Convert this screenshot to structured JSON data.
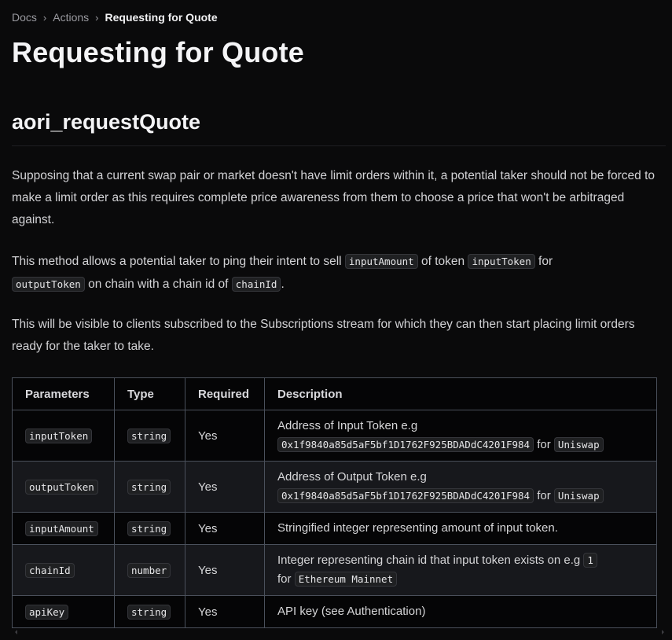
{
  "breadcrumb": {
    "items": [
      "Docs",
      "Actions",
      "Requesting for Quote"
    ],
    "separator": "›"
  },
  "page": {
    "title": "Requesting for Quote"
  },
  "section": {
    "title": "aori_requestQuote",
    "p1": "Supposing that a current swap pair or market doesn't have limit orders within it, a potential taker should not be forced to make a limit order as this requires complete price awareness from them to choose a price that won't be arbitraged against.",
    "p2": {
      "t1": "This method allows a potential taker to ping their intent to sell ",
      "c1": "inputAmount",
      "t2": " of token ",
      "c2": "inputToken",
      "t3": " for ",
      "c3": "outputToken",
      "t4": " on chain with a chain id of ",
      "c4": "chainId",
      "t5": "."
    },
    "p3": "This will be visible to clients subscribed to the Subscriptions stream for which they can then start placing limit orders ready for the taker to take."
  },
  "table": {
    "headers": [
      "Parameters",
      "Type",
      "Required",
      "Description"
    ],
    "rows": [
      {
        "param": "inputToken",
        "type": "string",
        "required": "Yes",
        "desc_text": "Address of Input Token e.g",
        "desc_code": "0x1f9840a85d5aF5bf1D1762F925BDADdC4201F984",
        "desc_mid": " for ",
        "desc_code2": "Uniswap"
      },
      {
        "param": "outputToken",
        "type": "string",
        "required": "Yes",
        "desc_text": "Address of Output Token e.g",
        "desc_code": "0x1f9840a85d5aF5bf1D1762F925BDADdC4201F984",
        "desc_mid": " for ",
        "desc_code2": "Uniswap"
      },
      {
        "param": "inputAmount",
        "type": "string",
        "required": "Yes",
        "desc_text": "Stringified integer representing amount of input token."
      },
      {
        "param": "chainId",
        "type": "number",
        "required": "Yes",
        "desc_text": "Integer representing chain id that input token exists on e.g ",
        "desc_code": "1",
        "desc_mid": "for ",
        "desc_code2": "Ethereum Mainnet"
      },
      {
        "param": "apiKey",
        "type": "string",
        "required": "Yes",
        "desc_text": "API key (see Authentication)"
      }
    ]
  },
  "scrollbar": {
    "left_icon": "scroll-left-arrow",
    "right_icon": "scroll-right-arrow"
  }
}
